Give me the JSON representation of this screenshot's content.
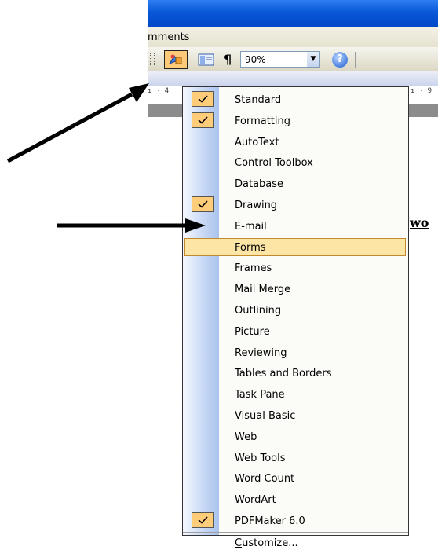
{
  "window": {
    "menubar_fragment": "mments"
  },
  "toolbar": {
    "zoom_value": "90%",
    "paragraph_glyph": "¶",
    "help_glyph": "?"
  },
  "ruler": {
    "left_tick": "ı · 4",
    "right_tick": "ı · 9"
  },
  "document": {
    "visible_text": "wo"
  },
  "menu": {
    "items": [
      {
        "label": "Standard",
        "checked": true
      },
      {
        "label": "Formatting",
        "checked": true
      },
      {
        "label": "AutoText",
        "checked": false
      },
      {
        "label": "Control Toolbox",
        "checked": false
      },
      {
        "label": "Database",
        "checked": false
      },
      {
        "label": "Drawing",
        "checked": true
      },
      {
        "label": "E-mail",
        "checked": false
      },
      {
        "label": "Forms",
        "checked": false,
        "highlighted": true
      },
      {
        "label": "Frames",
        "checked": false
      },
      {
        "label": "Mail Merge",
        "checked": false
      },
      {
        "label": "Outlining",
        "checked": false
      },
      {
        "label": "Picture",
        "checked": false
      },
      {
        "label": "Reviewing",
        "checked": false
      },
      {
        "label": "Tables and Borders",
        "checked": false
      },
      {
        "label": "Task Pane",
        "checked": false
      },
      {
        "label": "Visual Basic",
        "checked": false
      },
      {
        "label": "Web",
        "checked": false
      },
      {
        "label": "Web Tools",
        "checked": false
      },
      {
        "label": "Word Count",
        "checked": false
      },
      {
        "label": "WordArt",
        "checked": false
      },
      {
        "label": "PDFMaker 6.0",
        "checked": true
      },
      {
        "label": "Customize...",
        "checked": false
      }
    ]
  },
  "colors": {
    "titlebar": "#0a58d8",
    "check_bg": "#ffcc7a",
    "highlight_bg": "#fde6a5",
    "arrow": "#000000"
  },
  "icons": [
    "toolbar-grip-icon",
    "drawing-toolbar-icon",
    "document-map-icon",
    "show-formatting-icon",
    "help-icon",
    "checkmark-icon",
    "annotation-arrow-icon"
  ]
}
